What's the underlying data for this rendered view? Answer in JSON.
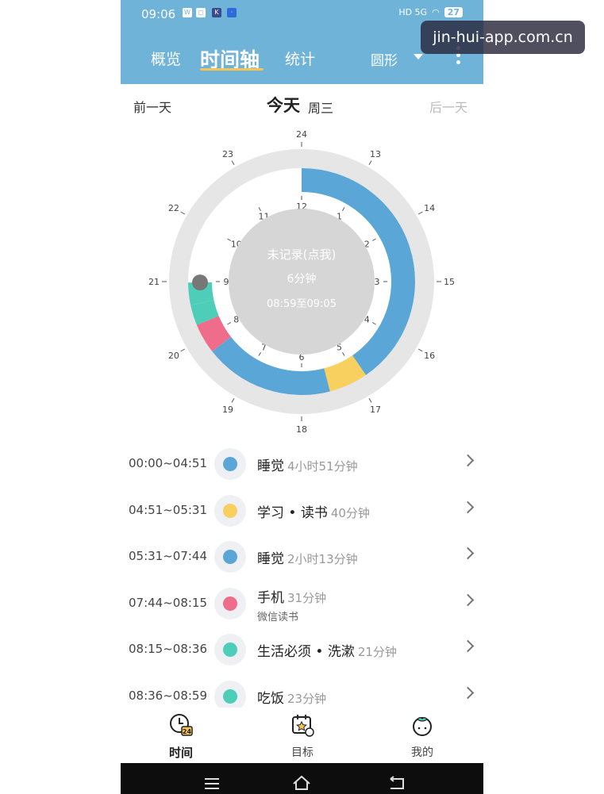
{
  "status_bar": {
    "time": "09:06",
    "icons": [
      "w-app-icon",
      "chat-app-icon",
      "k-app-icon",
      "news-app-icon"
    ],
    "network": "HD 5G",
    "battery": "27"
  },
  "header": {
    "tabs": [
      {
        "label": "概览",
        "active": false
      },
      {
        "label": "时间轴",
        "active": true
      },
      {
        "label": "统计",
        "active": false
      }
    ],
    "view_mode": "圆形"
  },
  "day_nav": {
    "prev": "前一天",
    "today": "今天",
    "weekday": "周三",
    "next": "后一天"
  },
  "clock": {
    "center_line1": "未记录(点我)",
    "center_line2": "6分钟",
    "center_line3": "08:59至09:05",
    "inner_hours": [
      "12",
      "1",
      "2",
      "3",
      "4",
      "5",
      "6",
      "7",
      "8",
      "9",
      "10",
      "11"
    ],
    "outer_hours": [
      "24",
      "13",
      "14",
      "15",
      "16",
      "17",
      "18",
      "19",
      "20",
      "21",
      "22",
      "23"
    ],
    "colors": {
      "sleep": "#5aa6d6",
      "study": "#f7d060",
      "phone": "#ef6d8a",
      "life": "#4ecdb9",
      "eat": "#4ecdb9",
      "track": "#e6e6e6",
      "center": "#d6d6d6",
      "unrecorded": "#777777"
    },
    "segments": [
      {
        "name": "睡觉",
        "start": "00:00",
        "end": "04:51",
        "color": "#5aa6d6"
      },
      {
        "name": "学习",
        "start": "04:51",
        "end": "05:31",
        "color": "#f7d060"
      },
      {
        "name": "睡觉",
        "start": "05:31",
        "end": "07:44",
        "color": "#5aa6d6"
      },
      {
        "name": "手机",
        "start": "07:44",
        "end": "08:15",
        "color": "#ef6d8a"
      },
      {
        "name": "生活必须",
        "start": "08:15",
        "end": "08:36",
        "color": "#4ecdb9"
      },
      {
        "name": "吃饭",
        "start": "08:36",
        "end": "08:59",
        "color": "#4ecdb9"
      }
    ]
  },
  "records": [
    {
      "time": "00:00~04:51",
      "title": "睡觉",
      "duration": "4小时51分钟",
      "sub": "",
      "color": "#5aa6d6"
    },
    {
      "time": "04:51~05:31",
      "title": "学习 • 读书",
      "duration": "40分钟",
      "sub": "",
      "color": "#f7d060"
    },
    {
      "time": "05:31~07:44",
      "title": "睡觉",
      "duration": "2小时13分钟",
      "sub": "",
      "color": "#5aa6d6"
    },
    {
      "time": "07:44~08:15",
      "title": "手机",
      "duration": "31分钟",
      "sub": "微信读书",
      "color": "#ef6d8a"
    },
    {
      "time": "08:15~08:36",
      "title": "生活必须 • 洗漱",
      "duration": "21分钟",
      "sub": "",
      "color": "#4ecdb9"
    },
    {
      "time": "08:36~08:59",
      "title": "吃饭",
      "duration": "23分钟",
      "sub": "",
      "color": "#4ecdb9"
    }
  ],
  "bottom_nav": [
    {
      "label": "时间",
      "icon": "clock-24-icon",
      "active": true
    },
    {
      "label": "目标",
      "icon": "calendar-goal-icon",
      "active": false
    },
    {
      "label": "我的",
      "icon": "tomato-icon",
      "active": false
    }
  ],
  "system_nav": [
    "menu-icon",
    "home-icon",
    "back-icon"
  ],
  "watermark": "jin-hui-app.com.cn"
}
